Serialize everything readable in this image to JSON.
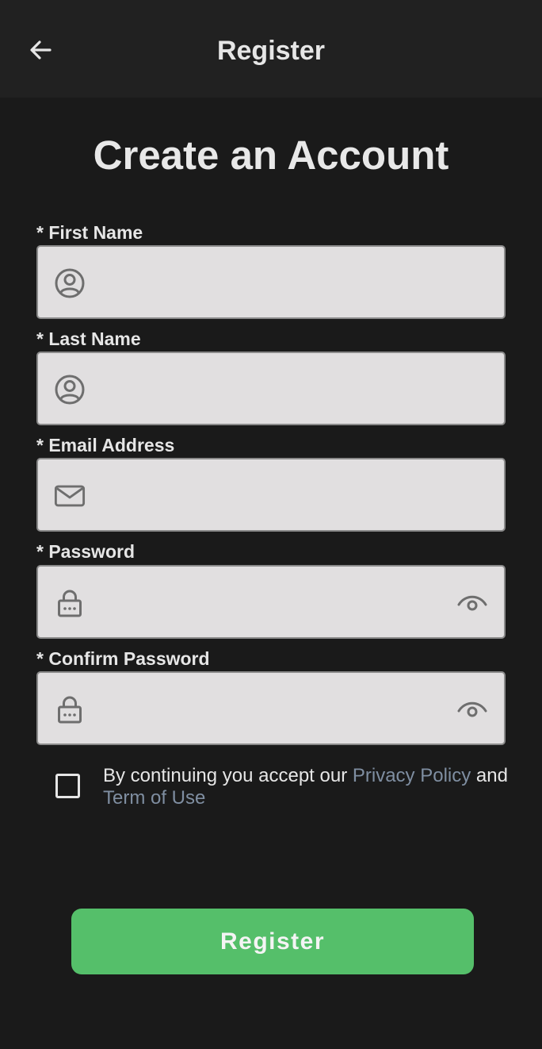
{
  "app_bar": {
    "title": "Register",
    "back_icon": "arrow-left-icon"
  },
  "page": {
    "title": "Create an Account"
  },
  "fields": {
    "first_name": {
      "label": "* First Name",
      "value": "",
      "icon": "user-circle-icon"
    },
    "last_name": {
      "label": "* Last Name",
      "value": "",
      "icon": "user-circle-icon"
    },
    "email": {
      "label": "* Email Address",
      "value": "",
      "icon": "envelope-icon"
    },
    "password": {
      "label": "* Password",
      "value": "",
      "icon": "lock-icon",
      "toggle_icon": "eye-icon"
    },
    "confirm_password": {
      "label": "* Confirm Password",
      "value": "",
      "icon": "lock-icon",
      "toggle_icon": "eye-icon"
    }
  },
  "consent": {
    "checked": false,
    "prefix": "By continuing you accept our ",
    "privacy_link": "Privacy Policy",
    "connector": " and ",
    "terms_link": "Term of Use"
  },
  "register_button": {
    "label": "Register"
  },
  "colors": {
    "background": "#1a1a1a",
    "app_bar": "#212121",
    "field_background": "#e1dfe0",
    "icon": "#6e6e6e",
    "link": "#7f8ea1",
    "primary_button": "#55bf6a"
  }
}
